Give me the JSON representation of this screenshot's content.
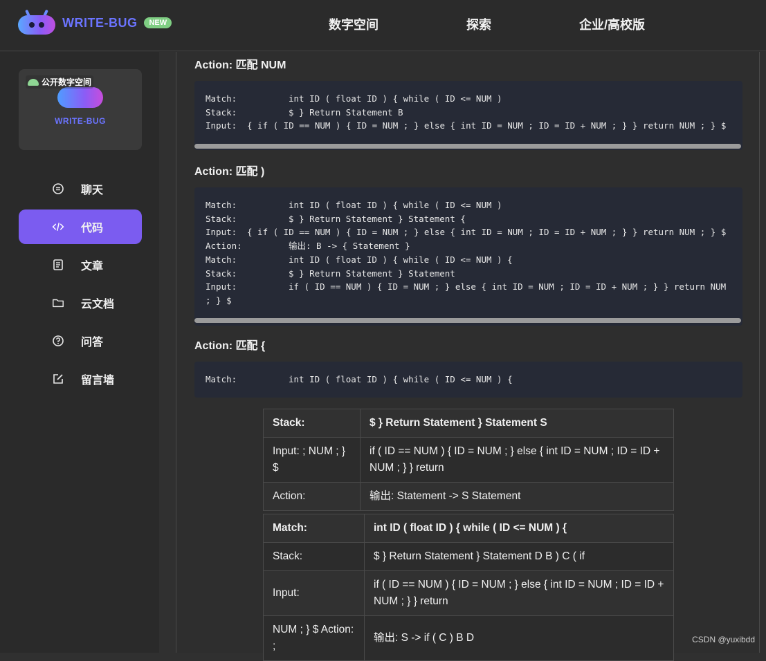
{
  "header": {
    "logo_text": "WRITE-BUG",
    "badge": "NEW",
    "nav": [
      "数字空间",
      "探索",
      "企业/高校版"
    ]
  },
  "sidebar": {
    "card": {
      "label": "公开数字空间",
      "brand": "WRITE-BUG"
    },
    "items": [
      {
        "label": "聊天",
        "icon": "chat-icon",
        "active": false
      },
      {
        "label": "代码",
        "icon": "code-icon",
        "active": true
      },
      {
        "label": "文章",
        "icon": "document-icon",
        "active": false
      },
      {
        "label": "云文档",
        "icon": "folder-icon",
        "active": false
      },
      {
        "label": "问答",
        "icon": "question-icon",
        "active": false
      },
      {
        "label": "留言墙",
        "icon": "edit-icon",
        "active": false
      }
    ]
  },
  "main": {
    "sections": [
      {
        "title": "Action: 匹配 NUM",
        "code": [
          {
            "k": "Match:",
            "v": "int ID ( float ID ) { while ( ID <= NUM )"
          },
          {
            "k": "Stack:",
            "v": "$ } Return Statement B"
          },
          {
            "k": "Input:  ",
            "v": "{ if ( ID == NUM ) { ID = NUM ; } else { int ID = NUM ; ID = ID + NUM ; } } return NUM ; } $"
          }
        ]
      },
      {
        "title": "Action: 匹配 )",
        "code": [
          {
            "k": "Match:",
            "v": "int ID ( float ID ) { while ( ID <= NUM )"
          },
          {
            "k": "Stack:",
            "v": "$ } Return Statement } Statement {"
          },
          {
            "k": "Input:  ",
            "v": "{ if ( ID == NUM ) { ID = NUM ; } else { int ID = NUM ; ID = ID + NUM ; } } return NUM ; } $"
          },
          {
            "k": "Action:",
            "v": "输出: B -> { Statement }"
          },
          {
            "k": "Match:",
            "v": "int ID ( float ID ) { while ( ID <= NUM ) {"
          },
          {
            "k": "Stack:",
            "v": "$ } Return Statement } Statement"
          },
          {
            "k": "Input:",
            "v": "if ( ID == NUM ) { ID = NUM ; } else { int ID = NUM ; ID = ID + NUM ; } } return NUM\n; } $"
          }
        ]
      },
      {
        "title": "Action: 匹配 {",
        "code": [
          {
            "k": "Match:",
            "v": "int ID ( float ID ) { while ( ID <= NUM ) {"
          }
        ]
      }
    ],
    "table1": [
      [
        "Stack:",
        "$ } Return Statement } Statement S"
      ],
      [
        "Input: ;  NUM ; } $",
        "if ( ID == NUM ) { ID = NUM ; } else { int ID = NUM ; ID = ID + NUM ; } } return"
      ],
      [
        "Action:",
        "输出: Statement -> S Statement"
      ]
    ],
    "table2": [
      [
        "Match:",
        "int ID ( float ID ) { while ( ID <= NUM ) {"
      ],
      [
        "Stack:",
        "$ } Return Statement } Statement D B ) C ( if"
      ],
      [
        "Input:",
        "if ( ID == NUM ) { ID = NUM ; } else { int ID = NUM ; ID = ID + NUM ; } } return"
      ],
      [
        "NUM ; } $ Action: ;",
        "输出: S -> if ( C ) B D"
      ]
    ]
  },
  "watermark": "CSDN @yuxibdd",
  "colors": {
    "accent": "#7b5cf0",
    "code_bg": "#262a36",
    "badge": "#7fce83"
  }
}
